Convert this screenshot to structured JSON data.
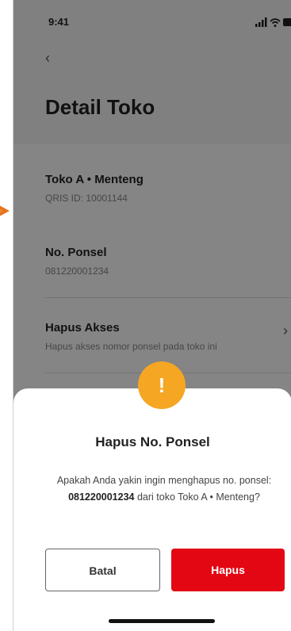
{
  "status_bar": {
    "time": "9:41",
    "icons": [
      "signal-icon",
      "wifi-icon",
      "battery-icon"
    ]
  },
  "header": {
    "title": "Detail Toko"
  },
  "store": {
    "name": "Toko A • Menteng",
    "qris": "QRIS ID: 10001144"
  },
  "phone": {
    "label": "No. Ponsel",
    "value": "081220001234"
  },
  "access": {
    "label": "Hapus Akses",
    "desc": "Hapus akses nomor ponsel pada toko ini"
  },
  "dialog": {
    "icon": "!",
    "title": "Hapus No. Ponsel",
    "message_prefix": "Apakah Anda yakin ingin menghapus no. ponsel: ",
    "message_number": "081220001234",
    "message_suffix": " dari toko Toko A • Menteng?",
    "cancel_label": "Batal",
    "confirm_label": "Hapus"
  },
  "colors": {
    "primary_red": "#e30613",
    "warning_orange": "#f5a623",
    "arrow_orange": "#e8731d"
  }
}
